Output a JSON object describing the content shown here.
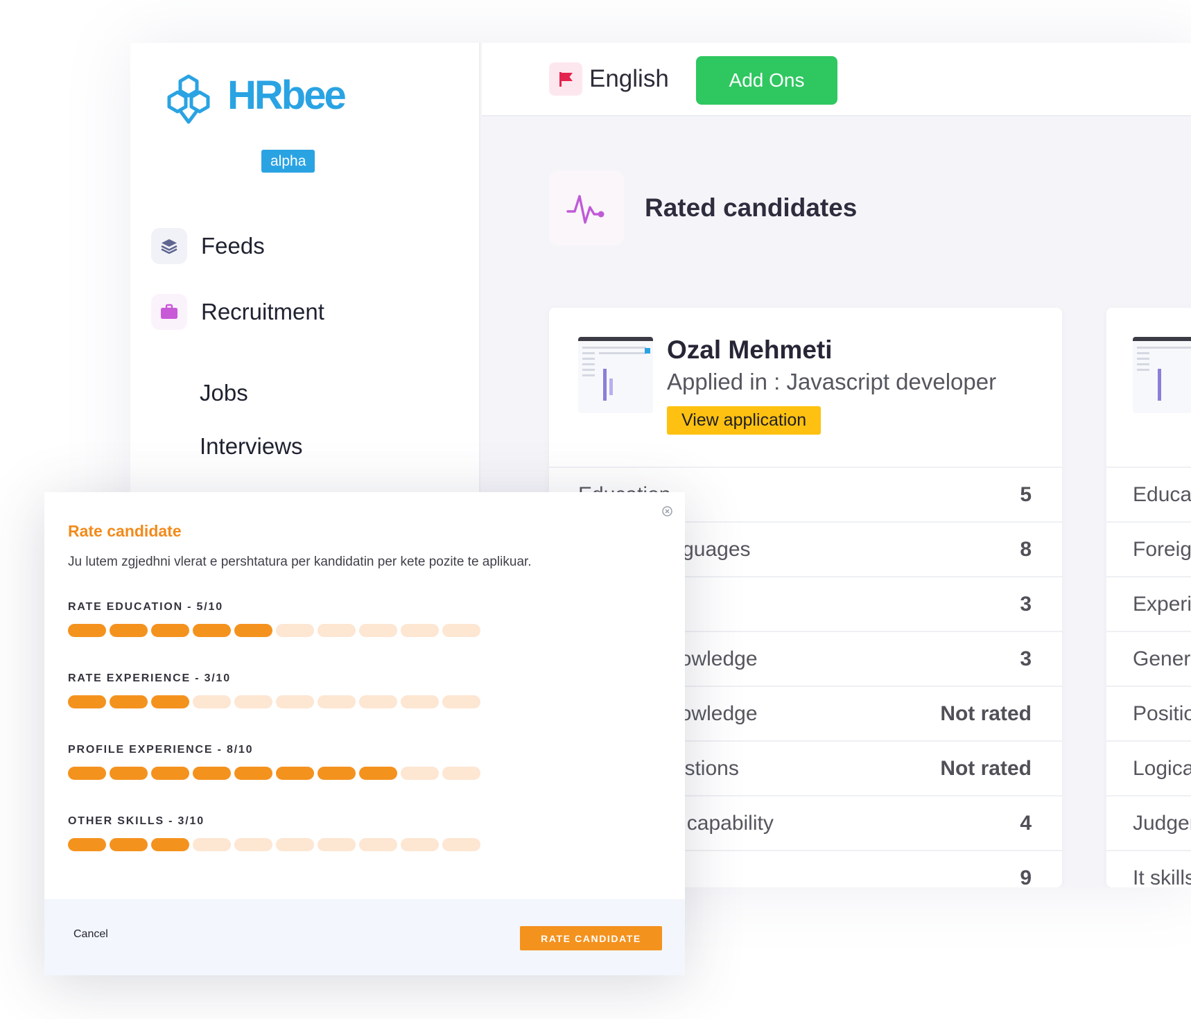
{
  "brand": {
    "name": "HRbee",
    "badge": "alpha",
    "color": "#2aa3e3"
  },
  "sidebar": {
    "items": [
      {
        "label": "Feeds",
        "icon": "layers-icon"
      },
      {
        "label": "Recruitment",
        "icon": "briefcase-icon"
      }
    ],
    "sub_items": [
      {
        "label": "Jobs"
      },
      {
        "label": "Interviews"
      }
    ]
  },
  "topbar": {
    "language": "English",
    "language_icon": "flag-icon",
    "addons_label": "Add Ons"
  },
  "page": {
    "title": "Rated candidates",
    "icon": "pulse-icon"
  },
  "candidate_card": {
    "name": "Ozal Mehmeti",
    "applied": "Applied in : Javascript developer",
    "view_label": "View application",
    "scores": [
      {
        "label": "Education",
        "value": "5"
      },
      {
        "label": "Foreign languages",
        "value": "8"
      },
      {
        "label": "",
        "value": "3"
      },
      {
        "label": "General knowledge",
        "value": "3"
      },
      {
        "label": "Position knowledge",
        "value": "Not rated"
      },
      {
        "label": "Logical questions",
        "value": "Not rated"
      },
      {
        "label": "Judgement capability",
        "value": "4"
      },
      {
        "label": "",
        "value": "9"
      }
    ]
  },
  "second_card": {
    "labels": [
      "Educat",
      "Foreig",
      "Experi",
      "Genera",
      "Positio",
      "Logica",
      "Judgen",
      "It skills"
    ]
  },
  "modal": {
    "title": "Rate candidate",
    "description": "Ju lutem zgjedhni vlerat e pershtatura per kandidatin per kete pozite te aplikuar.",
    "sections": [
      {
        "label": "RATE EDUCATION - 5/10",
        "value": 5,
        "max": 10
      },
      {
        "label": "RATE EXPERIENCE - 3/10",
        "value": 3,
        "max": 10
      },
      {
        "label": "PROFILE EXPERIENCE - 8/10",
        "value": 8,
        "max": 10
      },
      {
        "label": "OTHER SKILLS - 3/10",
        "value": 3,
        "max": 10
      }
    ],
    "cancel_label": "Cancel",
    "submit_label": "RATE CANDIDATE",
    "accent": "#f4921e"
  }
}
